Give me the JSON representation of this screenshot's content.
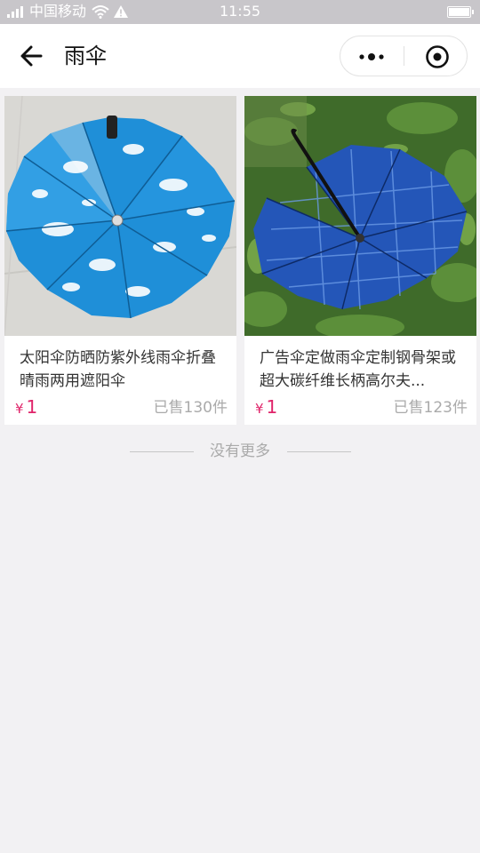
{
  "status_bar": {
    "carrier": "中国移动",
    "time": "11:55",
    "icons": [
      "signal-icon",
      "wifi-icon",
      "warning-icon",
      "battery-icon"
    ]
  },
  "nav": {
    "title": "雨伞",
    "back_icon": "arrow-left-icon",
    "menu_icon": "more-dots-icon",
    "close_icon": "target-circle-icon"
  },
  "products": [
    {
      "title": "太阳伞防晒防紫外线雨伞折叠晴雨两用遮阳伞",
      "price_symbol": "¥",
      "price": "1",
      "sold": "已售130件"
    },
    {
      "title": "广告伞定做雨伞定制钢骨架或超大碳纤维长柄高尔夫...",
      "price_symbol": "¥",
      "price": "1",
      "sold": "已售123件"
    }
  ],
  "footer": {
    "no_more": "没有更多"
  },
  "colors": {
    "price": "#e0246a",
    "background": "#f2f1f3",
    "status_bar": "#c8c6ca"
  }
}
